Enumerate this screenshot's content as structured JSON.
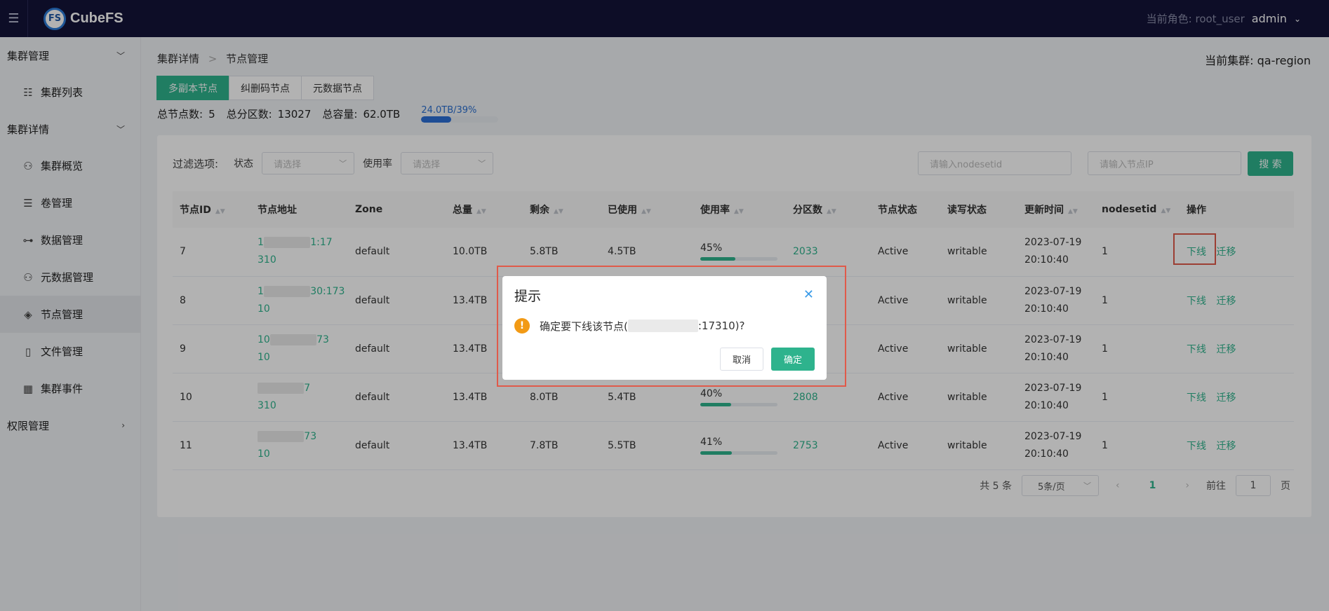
{
  "header": {
    "logo_mark": "FS",
    "app_name": "CubeFS",
    "role_label": "当前角色: root_user",
    "user": "admin"
  },
  "sidebar": {
    "groups": [
      {
        "label": "集群管理",
        "items": [
          {
            "label": "集群列表",
            "icon": "list-icon"
          }
        ]
      },
      {
        "label": "集群详情",
        "items": [
          {
            "label": "集群概览",
            "icon": "cluster-overview-icon"
          },
          {
            "label": "卷管理",
            "icon": "volume-icon"
          },
          {
            "label": "数据管理",
            "icon": "data-icon"
          },
          {
            "label": "元数据管理",
            "icon": "metadata-icon"
          },
          {
            "label": "节点管理",
            "icon": "layers-icon",
            "active": true
          },
          {
            "label": "文件管理",
            "icon": "file-icon"
          },
          {
            "label": "集群事件",
            "icon": "calendar-icon"
          }
        ]
      },
      {
        "label": "权限管理",
        "items": []
      }
    ]
  },
  "breadcrumb": {
    "parent": "集群详情",
    "current": "节点管理"
  },
  "current_cluster": "当前集群: qa-region",
  "tabs": [
    {
      "label": "多副本节点",
      "active": true
    },
    {
      "label": "纠删码节点",
      "active": false
    },
    {
      "label": "元数据节点",
      "active": false
    }
  ],
  "stats": {
    "node_count_label": "总节点数:",
    "node_count": "5",
    "partition_label": "总分区数:",
    "partition_count": "13027",
    "capacity_label": "总容量:",
    "capacity": "62.0TB",
    "used_text": "24.0TB/39%",
    "used_fraction": 0.39
  },
  "filter": {
    "label": "过滤选项:",
    "status_label": "状态",
    "status_placeholder": "请选择",
    "usage_label": "使用率",
    "usage_placeholder": "请选择",
    "nodesetid_placeholder": "请输入nodesetid",
    "ip_placeholder": "请输入节点IP",
    "search_label": "搜 索"
  },
  "table": {
    "headers": [
      "节点ID",
      "节点地址",
      "Zone",
      "总量",
      "剩余",
      "已使用",
      "使用率",
      "分区数",
      "节点状态",
      "读写状态",
      "更新时间",
      "nodesetid",
      "操作"
    ],
    "rows": [
      {
        "id": "7",
        "addr_a": "1",
        "addr_b": "1:17",
        "addr_c": "310",
        "zone": "default",
        "total": "10.0TB",
        "remain": "5.8TB",
        "used": "4.5TB",
        "usage": "45%",
        "usage_fraction": 0.45,
        "partitions": "2033",
        "status": "Active",
        "rw": "writable",
        "date": "2023-07-19",
        "time": "20:10:40",
        "nodesetid": "1"
      },
      {
        "id": "8",
        "addr_a": "1",
        "addr_b": "30:173",
        "addr_c": "10",
        "zone": "default",
        "total": "13.4TB",
        "remain": "",
        "used": "",
        "usage": "",
        "usage_fraction": 0,
        "partitions": "",
        "status": "Active",
        "rw": "writable",
        "date": "2023-07-19",
        "time": "20:10:40",
        "nodesetid": "1"
      },
      {
        "id": "9",
        "addr_a": "10",
        "addr_b": "73",
        "addr_c": "10",
        "zone": "default",
        "total": "13.4TB",
        "remain": "",
        "used": "",
        "usage": "",
        "usage_fraction": 0,
        "partitions": "",
        "status": "Active",
        "rw": "writable",
        "date": "2023-07-19",
        "time": "20:10:40",
        "nodesetid": "1"
      },
      {
        "id": "10",
        "addr_a": "",
        "addr_b": "7",
        "addr_c": "310",
        "zone": "default",
        "total": "13.4TB",
        "remain": "8.0TB",
        "used": "5.4TB",
        "usage": "40%",
        "usage_fraction": 0.4,
        "partitions": "2808",
        "status": "Active",
        "rw": "writable",
        "date": "2023-07-19",
        "time": "20:10:40",
        "nodesetid": "1"
      },
      {
        "id": "11",
        "addr_a": "",
        "addr_b": "73",
        "addr_c": "10",
        "zone": "default",
        "total": "13.4TB",
        "remain": "7.8TB",
        "used": "5.5TB",
        "usage": "41%",
        "usage_fraction": 0.41,
        "partitions": "2753",
        "status": "Active",
        "rw": "writable",
        "date": "2023-07-19",
        "time": "20:10:40",
        "nodesetid": "1"
      }
    ],
    "action_offline": "下线",
    "action_migrate": "迁移"
  },
  "pagination": {
    "total": "共 5 条",
    "page_size": "5条/页",
    "current_page": "1",
    "goto_label": "前往",
    "goto_value": "1",
    "page_suffix": "页"
  },
  "dialog": {
    "title": "提示",
    "message_prefix": "确定要下线该节点(",
    "message_suffix": ":17310)?",
    "cancel": "取消",
    "confirm": "确定"
  },
  "colors": {
    "accent": "#2eb38d",
    "header_bg": "#131339",
    "warning": "#f29a15",
    "highlight": "#e05a4a"
  }
}
